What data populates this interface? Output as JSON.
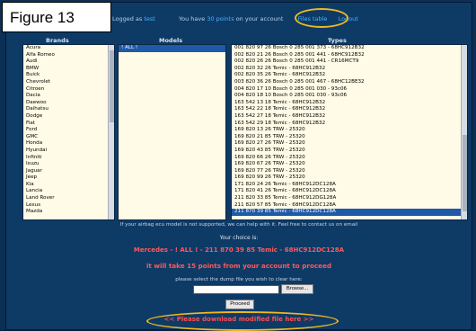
{
  "figure_label": "Figure 13",
  "topbar": {
    "logged_as_prefix": "Logged as",
    "logged_as_user": "test",
    "points_prefix": "You have",
    "points_value": "30 points",
    "points_suffix": "on your account",
    "files_table": "Files table",
    "logout": "Logout"
  },
  "columns": {
    "brands": "Brands",
    "models": "Models",
    "types": "Types"
  },
  "brands": [
    "Acura",
    "Alfa Romeo",
    "Audi",
    "BMW",
    "Buick",
    "Chevrolet",
    "Citroen",
    "Dacia",
    "Daewoo",
    "Daihatsu",
    "Dodge",
    "Fiat",
    "Ford",
    "GMC",
    "Honda",
    "Hyundai",
    "Infiniti",
    "Isuzu",
    "Jaguar",
    "Jeep",
    "Kia",
    "Lancia",
    "Land Rover",
    "Lexus",
    "Mazda"
  ],
  "models": [
    "! ALL !"
  ],
  "types": [
    "001 820 97 26 Bosch 0 285 001 373 - 68HC912B32",
    "002 820 21 26 Bosch 0 285 001 441 - 68HC912B32",
    "002 820 26 26 Bosch 0 285 001 441 - CR16MCT9",
    "002 820 32 26 Temic - 68HC912B32",
    "002 820 35 26 Temic - 68HC912B32",
    "003 820 36 26 Bosch 0 285 001 467 - 68HC12BE32",
    "004 820 17 10 Bosch 0 285 001 030 - 93c06",
    "004 820 18 10 Bosch 0 285 001 030 - 93c06",
    "163 542 13 18 Temic - 68HC912B32",
    "163 542 22 18 Temic - 68HC912B32",
    "163 542 27 18 Temic - 68HC912B32",
    "163 542 29 18 Temic - 68HC912B32",
    "169 820 13 26 TRW - 25320",
    "169 820 21 85 TRW - 25320",
    "169 820 27 26 TRW - 25320",
    "169 820 43 85 TRW - 25320",
    "169 820 66 26 TRW - 25320",
    "169 820 67 26 TRW - 25320",
    "169 820 77 26 TRW - 25320",
    "169 820 99 26 TRW - 25320",
    "171 820 24 26 Temic - 68HC912DC128A",
    "171 820 41 26 Temic - 68HC912DC128A",
    "211 820 33 85 Temic - 68HC912DG128A",
    "211 820 57 85 Temic - 68HC912DC128A",
    "211 870 39 85 Temic - 68HC912DC128A"
  ],
  "selected_type_index": 24,
  "not_supported_note": "If your airbag ecu model is not supported, we can help with it. Feel free to contact us on email",
  "your_choice_label": "Your choice is:",
  "your_choice_value": "Mercedes - ! ALL ! - 211 870 39 85 Temic - 68HC912DC128A",
  "cost_text": "it will take 15 points from your account to proceed",
  "dump_prompt": "please select the dump file you wish to clear here:",
  "browse_label": "Browse...",
  "proceed_label": "Proceed",
  "download_text": "<< Please download modified file here >>",
  "colors": {
    "accent_orange": "#f0b81f",
    "alert_red": "#ff5a5a",
    "background": "#0e3a66"
  }
}
